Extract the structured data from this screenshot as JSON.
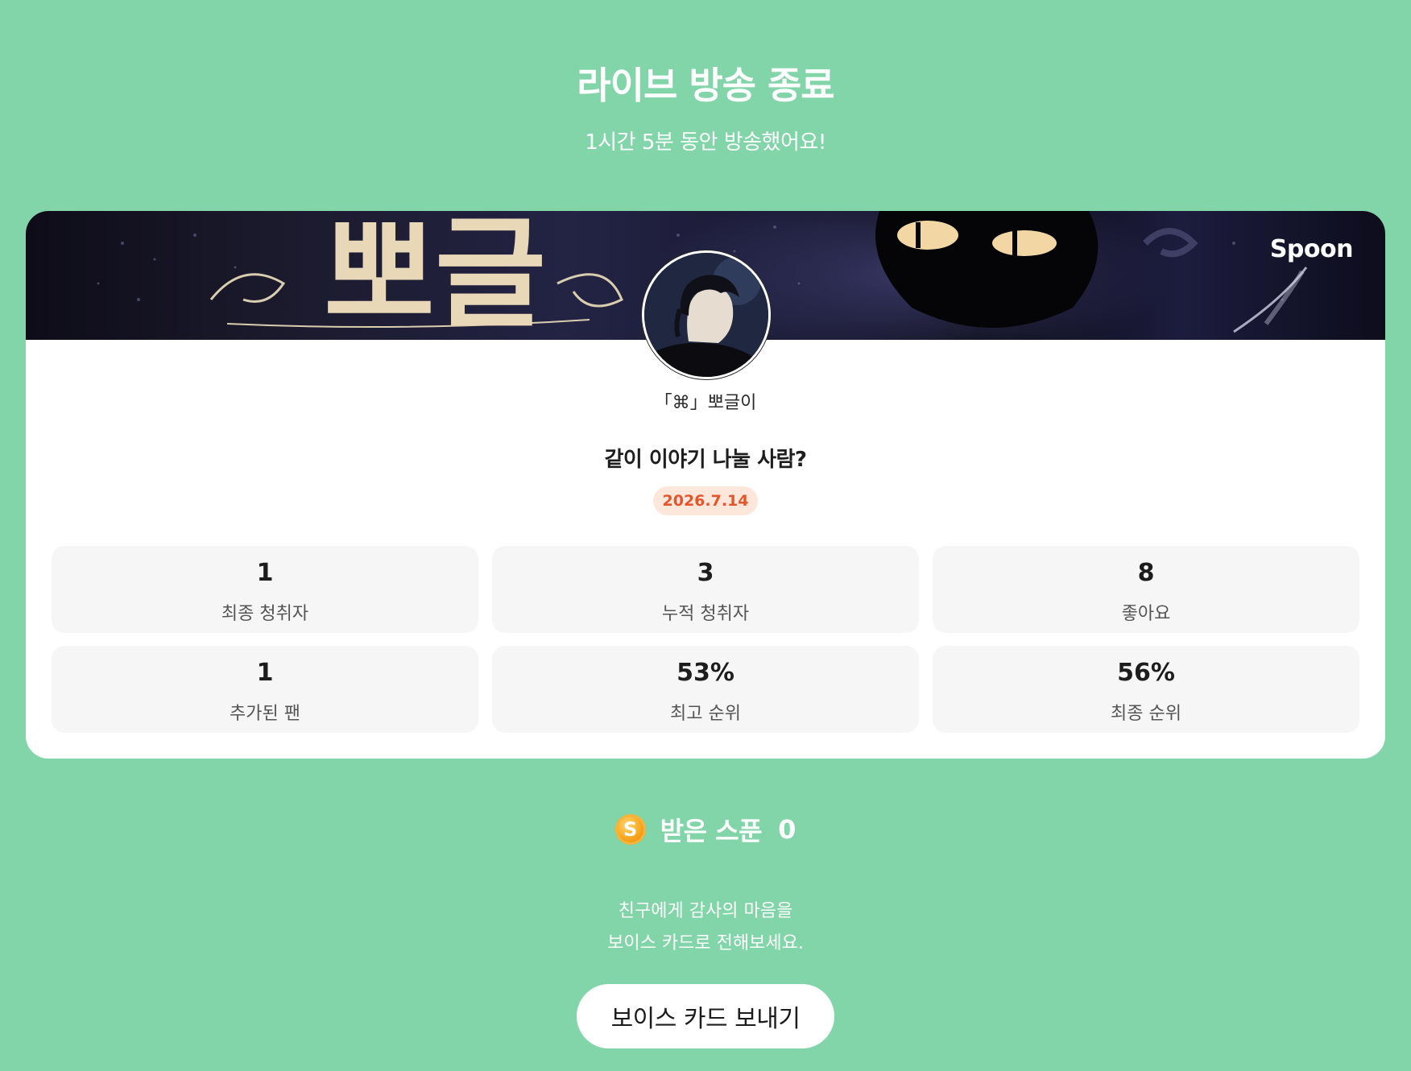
{
  "header": {
    "title": "라이브 방송 종료",
    "subtitle": "1시간 5분 동안 방송했어요!"
  },
  "card": {
    "brand": "Spoon",
    "banner_text": "뽀글",
    "nickname": "「⌘」뽀글이",
    "live_title": "같이 이야기 나눌 사람?",
    "date": "2026.7.14",
    "stats": [
      {
        "value": "1",
        "label": "최종 청취자"
      },
      {
        "value": "3",
        "label": "누적 청취자"
      },
      {
        "value": "8",
        "label": "좋아요"
      },
      {
        "value": "1",
        "label": "추가된 팬"
      },
      {
        "value": "53%",
        "label": "최고 순위"
      },
      {
        "value": "56%",
        "label": "최종 순위"
      }
    ]
  },
  "spoons": {
    "coin_symbol": "S",
    "label": "받은 스푼",
    "count": "0"
  },
  "thanks": {
    "line1": "친구에게 감사의 마음을",
    "line2": "보이스 카드로 전해보세요."
  },
  "voice_card_button": "보이스 카드 보내기",
  "colors": {
    "background": "#82d5a8",
    "date_badge_bg": "#fde6da",
    "date_badge_text": "#e5552c",
    "stat_box_bg": "#f6f6f6"
  }
}
